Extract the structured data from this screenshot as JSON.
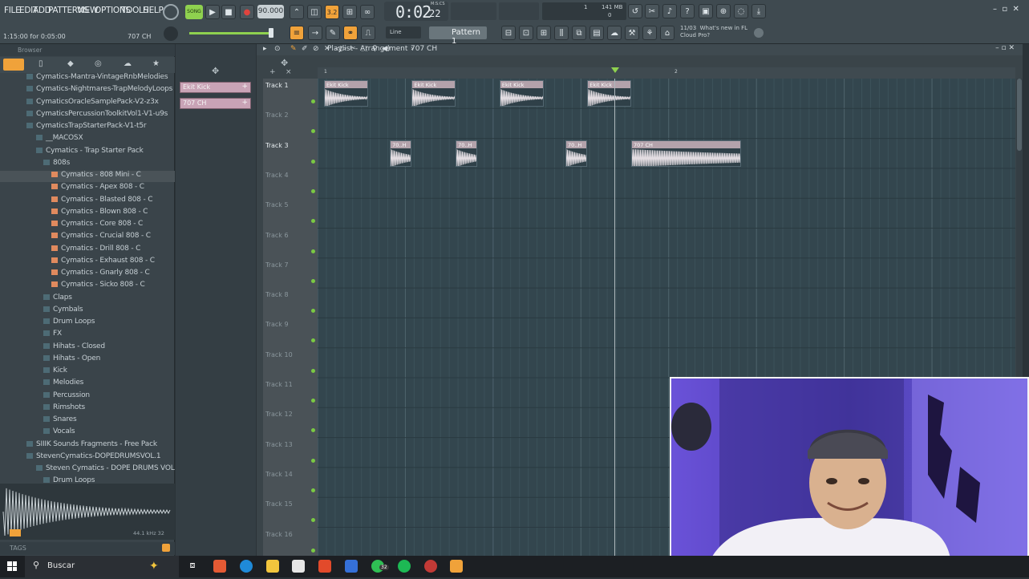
{
  "menu": [
    "FILE",
    "EDIT",
    "ADD",
    "PATTERNS",
    "VIEW",
    "OPTIONS",
    "TOOLS",
    "HELP"
  ],
  "transport": {
    "song_label": "SONG",
    "tempo": "90.000",
    "time": "0:02",
    "time_small": "22",
    "time_unit": "M:S:CS",
    "pattern": "Pattern 1",
    "snap": "Line",
    "cpu": "141 MB",
    "cpu_val": "0",
    "poly": "1"
  },
  "hint": {
    "left": "1:15:00 for 0:05:00",
    "right": "707 CH"
  },
  "news": {
    "date": "11/03",
    "line1": "What's new in FL",
    "line2": "Cloud Pro?"
  },
  "browser": {
    "title": "Browser",
    "tags_label": "TAGS",
    "wave_info": "44.1 kHz 32",
    "items": [
      {
        "label": "Cymatics-Mantra-VintageRnbMelodies",
        "indent": 0,
        "type": "folder"
      },
      {
        "label": "Cymatics-Nightmares-TrapMelodyLoops",
        "indent": 0,
        "type": "folder"
      },
      {
        "label": "CymaticsOracleSamplePack-V2-z3x",
        "indent": 0,
        "type": "folder"
      },
      {
        "label": "CymaticsPercussionToolkitVol1-V1-u9s",
        "indent": 0,
        "type": "folder"
      },
      {
        "label": "CymaticsTrapStarterPack-V1-t5r",
        "indent": 0,
        "type": "folder-open"
      },
      {
        "label": "__MACOSX",
        "indent": 1,
        "type": "folder"
      },
      {
        "label": "Cymatics - Trap Starter Pack",
        "indent": 1,
        "type": "folder-open"
      },
      {
        "label": "808s",
        "indent": 2,
        "type": "folder-open"
      },
      {
        "label": "Cymatics - 808 Mini - C",
        "indent": 3,
        "type": "file",
        "selected": true
      },
      {
        "label": "Cymatics - Apex 808 - C",
        "indent": 3,
        "type": "file"
      },
      {
        "label": "Cymatics - Blasted 808 - C",
        "indent": 3,
        "type": "file"
      },
      {
        "label": "Cymatics - Blown 808 - C",
        "indent": 3,
        "type": "file"
      },
      {
        "label": "Cymatics - Core 808 - C",
        "indent": 3,
        "type": "file"
      },
      {
        "label": "Cymatics - Crucial 808 - C",
        "indent": 3,
        "type": "file"
      },
      {
        "label": "Cymatics - Drill 808 - C",
        "indent": 3,
        "type": "file"
      },
      {
        "label": "Cymatics - Exhaust 808 - C",
        "indent": 3,
        "type": "file"
      },
      {
        "label": "Cymatics - Gnarly 808 - C",
        "indent": 3,
        "type": "file"
      },
      {
        "label": "Cymatics - Sicko 808 - C",
        "indent": 3,
        "type": "file"
      },
      {
        "label": "Claps",
        "indent": 2,
        "type": "folder"
      },
      {
        "label": "Cymbals",
        "indent": 2,
        "type": "folder"
      },
      {
        "label": "Drum Loops",
        "indent": 2,
        "type": "folder"
      },
      {
        "label": "FX",
        "indent": 2,
        "type": "folder"
      },
      {
        "label": "Hihats - Closed",
        "indent": 2,
        "type": "folder"
      },
      {
        "label": "Hihats - Open",
        "indent": 2,
        "type": "folder"
      },
      {
        "label": "Kick",
        "indent": 2,
        "type": "folder"
      },
      {
        "label": "Melodies",
        "indent": 2,
        "type": "folder"
      },
      {
        "label": "Percussion",
        "indent": 2,
        "type": "folder"
      },
      {
        "label": "Rimshots",
        "indent": 2,
        "type": "folder"
      },
      {
        "label": "Snares",
        "indent": 2,
        "type": "folder"
      },
      {
        "label": "Vocals",
        "indent": 2,
        "type": "folder"
      },
      {
        "label": "SIIIK Sounds Fragments - Free Pack",
        "indent": 0,
        "type": "folder"
      },
      {
        "label": "StevenCymatics-DOPEDRUMSVOL.1",
        "indent": 0,
        "type": "folder-open"
      },
      {
        "label": "Steven Cymatics - DOPE DRUMS VOL. 1",
        "indent": 1,
        "type": "folder-open"
      },
      {
        "label": "Drum Loops",
        "indent": 2,
        "type": "folder"
      },
      {
        "label": "Drum Shots",
        "indent": 2,
        "type": "folder"
      }
    ]
  },
  "channels": [
    "Ekit Kick",
    "707 CH"
  ],
  "playlist": {
    "title": "Playlist - Arrangement",
    "crumb": "707 CH",
    "bar_markers": [
      "1",
      "2"
    ],
    "tracks": [
      "Track 1",
      "Track 2",
      "Track 3",
      "Track 4",
      "Track 5",
      "Track 6",
      "Track 7",
      "Track 8",
      "Track 9",
      "Track 10",
      "Track 11",
      "Track 12",
      "Track 13",
      "Track 14",
      "Track 15",
      "Track 16"
    ],
    "clips": [
      {
        "track": 1,
        "start": 0,
        "len": 5,
        "label": "Ekit Kick"
      },
      {
        "track": 1,
        "start": 10,
        "len": 5,
        "label": "Ekit Kick"
      },
      {
        "track": 1,
        "start": 20,
        "len": 5,
        "label": "Ekit Kick"
      },
      {
        "track": 1,
        "start": 30,
        "len": 5,
        "label": "Ekit Kick"
      },
      {
        "track": 3,
        "start": 7.5,
        "len": 2.5,
        "label": "70..H"
      },
      {
        "track": 3,
        "start": 15,
        "len": 2.5,
        "label": "70..H"
      },
      {
        "track": 3,
        "start": 27.5,
        "len": 2.5,
        "label": "70..H"
      },
      {
        "track": 3,
        "start": 35,
        "len": 12.5,
        "label": "707 CH"
      }
    ]
  },
  "taskbar": {
    "search": "Buscar",
    "badge": "32"
  }
}
